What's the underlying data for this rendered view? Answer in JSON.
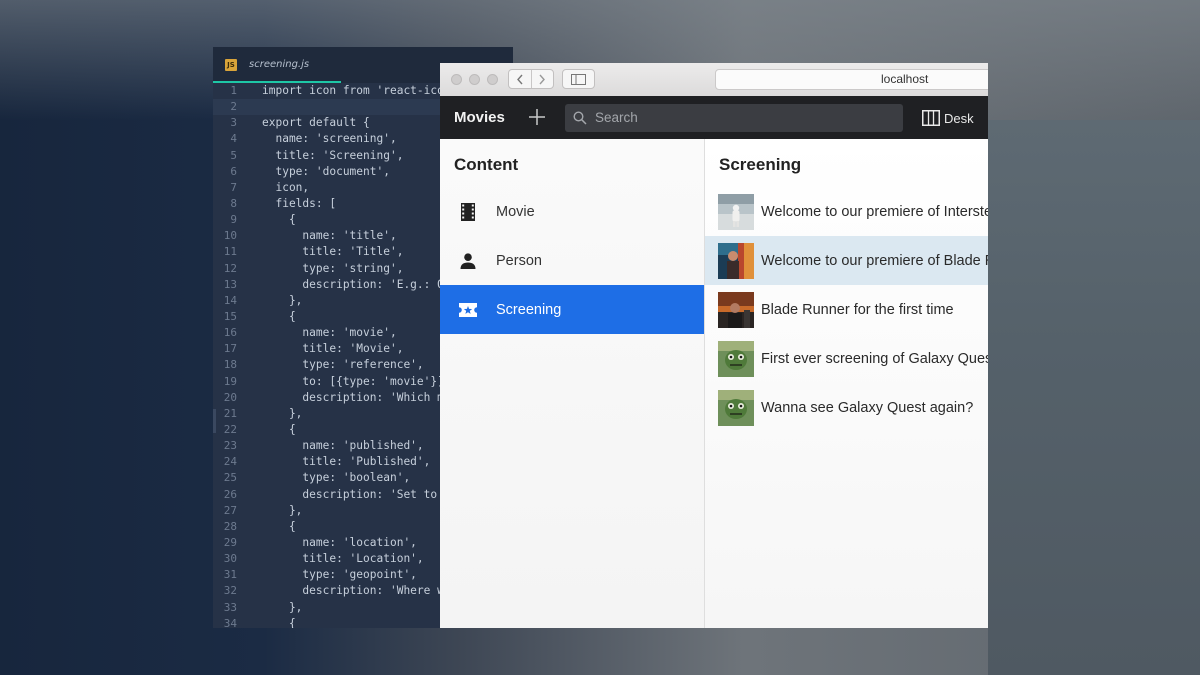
{
  "editor": {
    "file_name": "screening.js",
    "file_badge": "JS",
    "lines": [
      {
        "n": "1",
        "text": "import icon from 'react-icons/md/local-movies'"
      },
      {
        "n": "2",
        "text": ""
      },
      {
        "n": "3",
        "text": "export default {"
      },
      {
        "n": "4",
        "text": "  name: 'screening',"
      },
      {
        "n": "5",
        "text": "  title: 'Screening',"
      },
      {
        "n": "6",
        "text": "  type: 'document',"
      },
      {
        "n": "7",
        "text": "  icon,"
      },
      {
        "n": "8",
        "text": "  fields: ["
      },
      {
        "n": "9",
        "text": "    {"
      },
      {
        "n": "10",
        "text": "      name: 'title',"
      },
      {
        "n": "11",
        "text": "      title: 'Title',"
      },
      {
        "n": "12",
        "text": "      type: 'string',"
      },
      {
        "n": "13",
        "text": "      description: 'E.g.: Our first ever screening'"
      },
      {
        "n": "14",
        "text": "    },"
      },
      {
        "n": "15",
        "text": "    {"
      },
      {
        "n": "16",
        "text": "      name: 'movie',"
      },
      {
        "n": "17",
        "text": "      title: 'Movie',"
      },
      {
        "n": "18",
        "text": "      type: 'reference',"
      },
      {
        "n": "19",
        "text": "      to: [{type: 'movie'}],"
      },
      {
        "n": "20",
        "text": "      description: 'Which movie are we screening'"
      },
      {
        "n": "21",
        "text": "    },"
      },
      {
        "n": "22",
        "text": "    {"
      },
      {
        "n": "23",
        "text": "      name: 'published',"
      },
      {
        "n": "24",
        "text": "      title: 'Published',"
      },
      {
        "n": "25",
        "text": "      type: 'boolean',"
      },
      {
        "n": "26",
        "text": "      description: 'Set to published when ready'"
      },
      {
        "n": "27",
        "text": "    },"
      },
      {
        "n": "28",
        "text": "    {"
      },
      {
        "n": "29",
        "text": "      name: 'location',"
      },
      {
        "n": "30",
        "text": "      title: 'Location',"
      },
      {
        "n": "31",
        "text": "      type: 'geopoint',"
      },
      {
        "n": "32",
        "text": "      description: 'Where will the screening take place?'"
      },
      {
        "n": "33",
        "text": "    },"
      },
      {
        "n": "34",
        "text": "    {"
      }
    ]
  },
  "browser": {
    "url": "localhost"
  },
  "app": {
    "brand": "Movies",
    "search_placeholder": "Search",
    "tool_label": "Desk",
    "content_title": "Content",
    "types": [
      {
        "label": "Movie",
        "icon": "film-icon"
      },
      {
        "label": "Person",
        "icon": "person-icon"
      },
      {
        "label": "Screening",
        "icon": "ticket-icon"
      }
    ],
    "docs_title": "Screening",
    "documents": [
      {
        "title": "Welcome to our premiere of Interstellar"
      },
      {
        "title": "Welcome to our premiere of Blade Runner"
      },
      {
        "title": "Blade Runner for the first time"
      },
      {
        "title": "First ever screening of Galaxy Quest"
      },
      {
        "title": "Wanna see Galaxy Quest again?"
      }
    ]
  },
  "colors": {
    "selected": "#1e6ee6",
    "highlight_row": "#dbe8f1",
    "app_bar": "#1f2023",
    "editor_bg": "#263247"
  }
}
